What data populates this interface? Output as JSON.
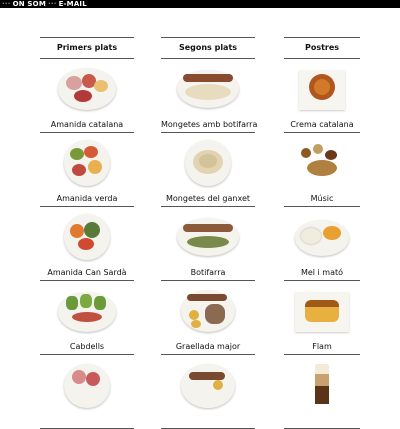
{
  "nav": {
    "sep1": "···",
    "on_som": "ON SOM",
    "sep2": "···",
    "email": "E-MAIL"
  },
  "columns": [
    {
      "header": "Primers plats",
      "items": [
        {
          "label": "Amanida catalana",
          "icon": "salad-plate"
        },
        {
          "label": "Amanida verda",
          "icon": "salad-plate"
        },
        {
          "label": "Amanida Can Sardà",
          "icon": "salad-plate"
        },
        {
          "label": "Cabdells",
          "icon": "salad-plate"
        },
        {
          "label": "",
          "icon": "salad-plate"
        }
      ]
    },
    {
      "header": "Segons plats",
      "items": [
        {
          "label": "Mongetes amb botifarra",
          "icon": "sausage-plate"
        },
        {
          "label": "Mongetes del ganxet",
          "icon": "beans-plate"
        },
        {
          "label": "Botifarra",
          "icon": "sausage-plate"
        },
        {
          "label": "Graellada major",
          "icon": "grill-plate"
        },
        {
          "label": "",
          "icon": "grill-plate"
        }
      ]
    },
    {
      "header": "Postres",
      "items": [
        {
          "label": "Crema catalana",
          "icon": "dessert-plate"
        },
        {
          "label": "Músic",
          "icon": "dessert-plate"
        },
        {
          "label": "Mel i mató",
          "icon": "dessert-plate"
        },
        {
          "label": "Flam",
          "icon": "dessert-plate"
        },
        {
          "label": "",
          "icon": "coffee-glass"
        }
      ]
    }
  ],
  "colors": {
    "topbar": "#000000",
    "rule": "#555555",
    "text": "#111111"
  }
}
